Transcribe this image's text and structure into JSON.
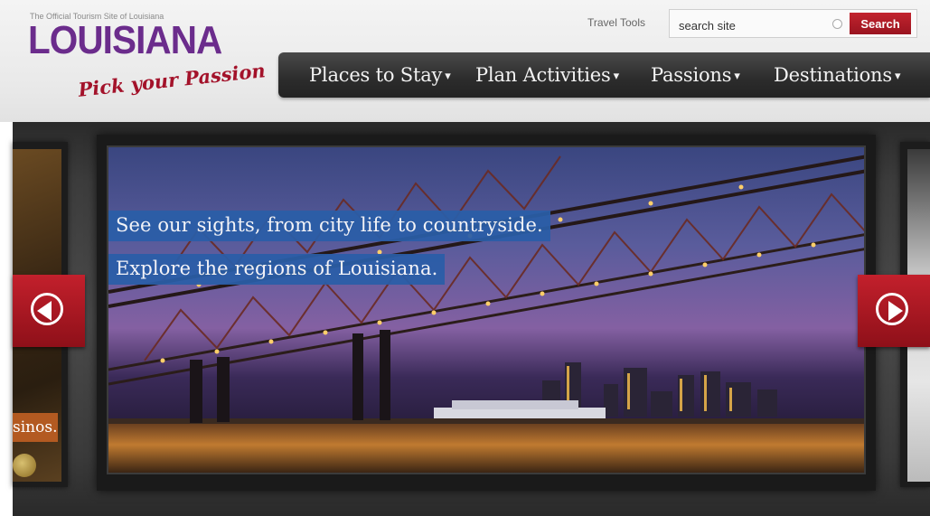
{
  "header": {
    "tagline": "The Official Tourism Site of Louisiana",
    "logo_text": "LOUISIANA",
    "logo_script": "Pick your Passion",
    "travel_tools": "Travel Tools",
    "search": {
      "value": "search site",
      "button_label": "Search"
    }
  },
  "nav": {
    "items": [
      {
        "label": "Places to Stay"
      },
      {
        "label": "Plan Activities"
      },
      {
        "label": "Passions"
      },
      {
        "label": "Destinations"
      }
    ],
    "caret": "▾"
  },
  "carousel": {
    "slide": {
      "caption_line1": "See our sights, from city life to countryside.",
      "caption_line2": "Explore the regions of Louisiana."
    },
    "left_peek_caption": "sinos.",
    "prev_icon": "arrow-left-circle",
    "next_icon": "arrow-right-circle"
  },
  "colors": {
    "brand_purple": "#6b2c8c",
    "brand_red": "#a3122a",
    "search_button": "#b01b26",
    "nav_background": "#2c2c2c",
    "caption_blue": "#2a5ea8",
    "peek_caption_orange": "#b35a21"
  }
}
